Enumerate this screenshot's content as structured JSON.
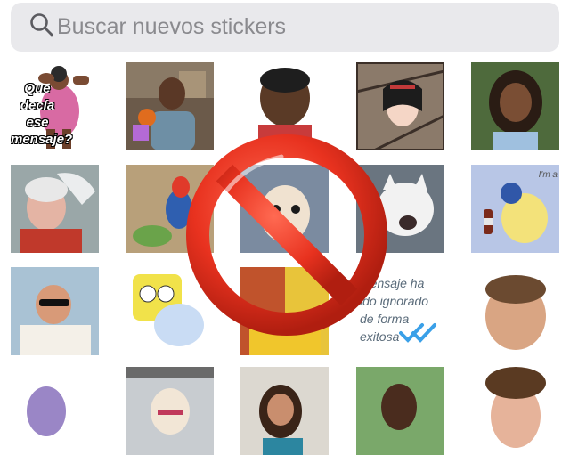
{
  "search": {
    "placeholder": "Buscar nuevos stickers",
    "icon": "magnifier-icon"
  },
  "stickers": {
    "s1": {
      "caption": "Que decía ese mensaje?"
    },
    "s13": {
      "lines": [
        "mensaje ha",
        "ido ignorado",
        "de forma",
        "exitosa"
      ]
    },
    "s10": {
      "corner": "I'm a"
    }
  },
  "overlay": {
    "icon": "prohibited-icon",
    "color": "#e8321f"
  },
  "colors": {
    "search_bg": "#e9e9ec",
    "placeholder": "#8a8a8e",
    "check": "#3aa0e8"
  }
}
